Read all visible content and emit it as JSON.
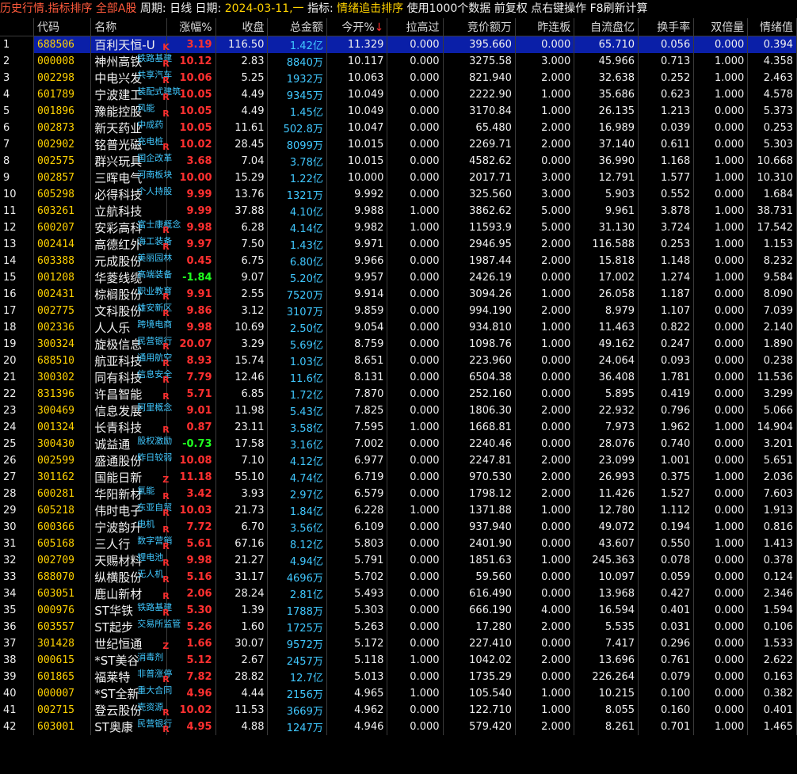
{
  "titlebar": {
    "part1": "历史行情.指标排序",
    "part2": " 全部A股",
    "part3": " 周期: 日线",
    "part4": " 日期: ",
    "date": "2024-03-11,一",
    "part5": " 指标: ",
    "indicator": "情绪追击排序",
    "part6": " 使用1000个数据 前复权 点右键操作 F8刷新计算"
  },
  "columns": [
    "",
    "代码",
    "名称",
    "涨幅%",
    "收盘",
    "总金额",
    "今开%",
    "拉高过",
    "竞价额万",
    "昨连板",
    "自流盘亿",
    "换手率",
    "双倍量",
    "情绪值"
  ],
  "sort_arrow": "↓",
  "rows": [
    {
      "i": "1",
      "code": "688506",
      "name": "百利天恒-U",
      "concept": "",
      "mark": "K",
      "chg": "3.19",
      "close": "116.50",
      "amt": "1.42亿",
      "open": "11.329",
      "lg": "0.000",
      "bid": "395.660",
      "lb": "0.000",
      "cap": "65.710",
      "turn": "0.056",
      "dv": "0.000",
      "emo": "0.394"
    },
    {
      "i": "2",
      "code": "000008",
      "name": "神州高铁",
      "concept": "铁路基建",
      "mark": "R",
      "chg": "10.12",
      "close": "2.83",
      "amt": "8840万",
      "open": "10.117",
      "lg": "0.000",
      "bid": "3275.58",
      "lb": "3.000",
      "cap": "45.966",
      "turn": "0.713",
      "dv": "1.000",
      "emo": "4.358"
    },
    {
      "i": "3",
      "code": "002298",
      "name": "中电兴发",
      "concept": "共享汽车",
      "mark": "R",
      "chg": "10.06",
      "close": "5.25",
      "amt": "1932万",
      "open": "10.063",
      "lg": "0.000",
      "bid": "821.940",
      "lb": "2.000",
      "cap": "32.638",
      "turn": "0.252",
      "dv": "1.000",
      "emo": "2.463"
    },
    {
      "i": "4",
      "code": "601789",
      "name": "宁波建工",
      "concept": "装配式建筑",
      "mark": "R",
      "chg": "10.05",
      "close": "4.49",
      "amt": "9345万",
      "open": "10.049",
      "lg": "0.000",
      "bid": "2222.90",
      "lb": "1.000",
      "cap": "35.686",
      "turn": "0.623",
      "dv": "1.000",
      "emo": "4.578"
    },
    {
      "i": "5",
      "code": "001896",
      "name": "豫能控股",
      "concept": "风能",
      "mark": "R",
      "chg": "10.05",
      "close": "4.49",
      "amt": "1.45亿",
      "open": "10.049",
      "lg": "0.000",
      "bid": "3170.84",
      "lb": "1.000",
      "cap": "26.135",
      "turn": "1.213",
      "dv": "0.000",
      "emo": "5.373"
    },
    {
      "i": "6",
      "code": "002873",
      "name": "新天药业",
      "concept": "中成药",
      "mark": "",
      "chg": "10.05",
      "close": "11.61",
      "amt": "502.8万",
      "open": "10.047",
      "lg": "0.000",
      "bid": "65.480",
      "lb": "2.000",
      "cap": "16.989",
      "turn": "0.039",
      "dv": "0.000",
      "emo": "0.253"
    },
    {
      "i": "7",
      "code": "002902",
      "name": "铭普光磁",
      "concept": "充电桩",
      "mark": "R",
      "chg": "10.02",
      "close": "28.45",
      "amt": "8099万",
      "open": "10.015",
      "lg": "0.000",
      "bid": "2269.71",
      "lb": "2.000",
      "cap": "37.140",
      "turn": "0.611",
      "dv": "0.000",
      "emo": "5.303"
    },
    {
      "i": "8",
      "code": "002575",
      "name": "群兴玩具",
      "concept": "国企改革",
      "mark": "",
      "chg": "3.68",
      "close": "7.04",
      "amt": "3.78亿",
      "open": "10.015",
      "lg": "0.000",
      "bid": "4582.62",
      "lb": "0.000",
      "cap": "36.990",
      "turn": "1.168",
      "dv": "1.000",
      "emo": "10.668"
    },
    {
      "i": "9",
      "code": "002857",
      "name": "三晖电气",
      "concept": "河南板块",
      "mark": "",
      "chg": "10.00",
      "close": "15.29",
      "amt": "1.22亿",
      "open": "10.000",
      "lg": "0.000",
      "bid": "2017.71",
      "lb": "3.000",
      "cap": "12.791",
      "turn": "1.577",
      "dv": "1.000",
      "emo": "10.310"
    },
    {
      "i": "10",
      "code": "605298",
      "name": "必得科技",
      "concept": "个人持股",
      "mark": "",
      "chg": "9.99",
      "close": "13.76",
      "amt": "1321万",
      "open": "9.992",
      "lg": "0.000",
      "bid": "325.560",
      "lb": "3.000",
      "cap": "5.903",
      "turn": "0.552",
      "dv": "0.000",
      "emo": "1.684"
    },
    {
      "i": "11",
      "code": "603261",
      "name": "立航科技",
      "concept": "",
      "mark": "",
      "chg": "9.99",
      "close": "37.88",
      "amt": "4.10亿",
      "open": "9.988",
      "lg": "1.000",
      "bid": "3862.62",
      "lb": "5.000",
      "cap": "9.961",
      "turn": "3.878",
      "dv": "1.000",
      "emo": "38.731"
    },
    {
      "i": "12",
      "code": "600207",
      "name": "安彩高科",
      "concept": "富士康概念",
      "mark": "R",
      "chg": "9.98",
      "close": "6.28",
      "amt": "4.14亿",
      "open": "9.982",
      "lg": "1.000",
      "bid": "11593.9",
      "lb": "5.000",
      "cap": "31.130",
      "turn": "3.724",
      "dv": "1.000",
      "emo": "17.542"
    },
    {
      "i": "13",
      "code": "002414",
      "name": "高德红外",
      "concept": "海工装备",
      "mark": "R",
      "chg": "9.97",
      "close": "7.50",
      "amt": "1.43亿",
      "open": "9.971",
      "lg": "0.000",
      "bid": "2946.95",
      "lb": "2.000",
      "cap": "116.588",
      "turn": "0.253",
      "dv": "1.000",
      "emo": "1.153"
    },
    {
      "i": "14",
      "code": "603388",
      "name": "元成股份",
      "concept": "美丽园林",
      "mark": "",
      "chg": "0.45",
      "close": "6.75",
      "amt": "6.80亿",
      "open": "9.966",
      "lg": "0.000",
      "bid": "1987.44",
      "lb": "2.000",
      "cap": "15.818",
      "turn": "1.148",
      "dv": "0.000",
      "emo": "8.232"
    },
    {
      "i": "15",
      "code": "001208",
      "name": "华菱线缆",
      "concept": "高端装备",
      "mark": "",
      "chg": "-1.84",
      "close": "9.07",
      "amt": "5.20亿",
      "open": "9.957",
      "lg": "0.000",
      "bid": "2426.19",
      "lb": "0.000",
      "cap": "17.002",
      "turn": "1.274",
      "dv": "1.000",
      "emo": "9.584"
    },
    {
      "i": "16",
      "code": "002431",
      "name": "棕榈股份",
      "concept": "职业教育",
      "mark": "R",
      "chg": "9.91",
      "close": "2.55",
      "amt": "7520万",
      "open": "9.914",
      "lg": "0.000",
      "bid": "3094.26",
      "lb": "1.000",
      "cap": "26.058",
      "turn": "1.187",
      "dv": "0.000",
      "emo": "8.090"
    },
    {
      "i": "17",
      "code": "002775",
      "name": "文科股份",
      "concept": "雄安新区",
      "mark": "R",
      "chg": "9.86",
      "close": "3.12",
      "amt": "3107万",
      "open": "9.859",
      "lg": "0.000",
      "bid": "994.190",
      "lb": "2.000",
      "cap": "8.979",
      "turn": "1.107",
      "dv": "0.000",
      "emo": "7.039"
    },
    {
      "i": "18",
      "code": "002336",
      "name": "人人乐",
      "concept": "跨境电商",
      "mark": "",
      "chg": "9.98",
      "close": "10.69",
      "amt": "2.50亿",
      "open": "9.054",
      "lg": "0.000",
      "bid": "934.810",
      "lb": "1.000",
      "cap": "11.463",
      "turn": "0.822",
      "dv": "0.000",
      "emo": "2.140"
    },
    {
      "i": "19",
      "code": "300324",
      "name": "旋极信息",
      "concept": "民营银行",
      "mark": "R",
      "chg": "20.07",
      "close": "3.29",
      "amt": "5.69亿",
      "open": "8.759",
      "lg": "0.000",
      "bid": "1098.76",
      "lb": "1.000",
      "cap": "49.162",
      "turn": "0.247",
      "dv": "0.000",
      "emo": "1.890"
    },
    {
      "i": "20",
      "code": "688510",
      "name": "航亚科技",
      "concept": "通用航空",
      "mark": "R",
      "chg": "8.93",
      "close": "15.74",
      "amt": "1.03亿",
      "open": "8.651",
      "lg": "0.000",
      "bid": "223.960",
      "lb": "0.000",
      "cap": "24.064",
      "turn": "0.093",
      "dv": "0.000",
      "emo": "0.238"
    },
    {
      "i": "21",
      "code": "300302",
      "name": "同有科技",
      "concept": "信息安全",
      "mark": "R",
      "chg": "7.79",
      "close": "12.46",
      "amt": "11.6亿",
      "open": "8.131",
      "lg": "0.000",
      "bid": "6504.38",
      "lb": "0.000",
      "cap": "36.408",
      "turn": "1.781",
      "dv": "0.000",
      "emo": "11.536"
    },
    {
      "i": "22",
      "code": "831396",
      "name": "许昌智能",
      "concept": "",
      "mark": "R",
      "chg": "5.71",
      "close": "6.85",
      "amt": "1.72亿",
      "open": "7.870",
      "lg": "0.000",
      "bid": "252.160",
      "lb": "0.000",
      "cap": "5.895",
      "turn": "0.419",
      "dv": "0.000",
      "emo": "3.299"
    },
    {
      "i": "23",
      "code": "300469",
      "name": "信息发展",
      "concept": "阿里概念",
      "mark": "",
      "chg": "9.01",
      "close": "11.98",
      "amt": "5.43亿",
      "open": "7.825",
      "lg": "0.000",
      "bid": "1806.30",
      "lb": "2.000",
      "cap": "22.932",
      "turn": "0.796",
      "dv": "0.000",
      "emo": "5.066"
    },
    {
      "i": "24",
      "code": "001324",
      "name": "长青科技",
      "concept": "",
      "mark": "R",
      "chg": "0.87",
      "close": "23.11",
      "amt": "3.58亿",
      "open": "7.595",
      "lg": "1.000",
      "bid": "1668.81",
      "lb": "0.000",
      "cap": "7.973",
      "turn": "1.962",
      "dv": "1.000",
      "emo": "14.904"
    },
    {
      "i": "25",
      "code": "300430",
      "name": "诚益通",
      "concept": "股权激励",
      "mark": "",
      "chg": "-0.73",
      "close": "17.58",
      "amt": "3.16亿",
      "open": "7.002",
      "lg": "0.000",
      "bid": "2240.46",
      "lb": "0.000",
      "cap": "28.076",
      "turn": "0.740",
      "dv": "0.000",
      "emo": "3.201"
    },
    {
      "i": "26",
      "code": "002599",
      "name": "盛通股份",
      "concept": "昨日较弱",
      "mark": "",
      "chg": "10.08",
      "close": "7.10",
      "amt": "4.12亿",
      "open": "6.977",
      "lg": "0.000",
      "bid": "2247.81",
      "lb": "2.000",
      "cap": "23.099",
      "turn": "1.001",
      "dv": "0.000",
      "emo": "5.651"
    },
    {
      "i": "27",
      "code": "301162",
      "name": "国能日新",
      "concept": "",
      "mark": "Z",
      "chg": "11.18",
      "close": "55.10",
      "amt": "4.74亿",
      "open": "6.719",
      "lg": "0.000",
      "bid": "970.530",
      "lb": "2.000",
      "cap": "26.993",
      "turn": "0.375",
      "dv": "1.000",
      "emo": "2.036"
    },
    {
      "i": "28",
      "code": "600281",
      "name": "华阳新材",
      "concept": "氢能",
      "mark": "R",
      "chg": "3.42",
      "close": "3.93",
      "amt": "2.97亿",
      "open": "6.579",
      "lg": "0.000",
      "bid": "1798.12",
      "lb": "2.000",
      "cap": "11.426",
      "turn": "1.527",
      "dv": "0.000",
      "emo": "7.603"
    },
    {
      "i": "29",
      "code": "605218",
      "name": "伟时电子",
      "concept": "东亚自贸",
      "mark": "R",
      "chg": "10.03",
      "close": "21.73",
      "amt": "1.84亿",
      "open": "6.228",
      "lg": "1.000",
      "bid": "1371.88",
      "lb": "1.000",
      "cap": "12.780",
      "turn": "1.112",
      "dv": "0.000",
      "emo": "1.913"
    },
    {
      "i": "30",
      "code": "600366",
      "name": "宁波韵升",
      "concept": "电机",
      "mark": "R",
      "chg": "7.72",
      "close": "6.70",
      "amt": "3.56亿",
      "open": "6.109",
      "lg": "0.000",
      "bid": "937.940",
      "lb": "0.000",
      "cap": "49.072",
      "turn": "0.194",
      "dv": "1.000",
      "emo": "0.816"
    },
    {
      "i": "31",
      "code": "605168",
      "name": "三人行",
      "concept": "数字营销",
      "mark": "R",
      "chg": "5.61",
      "close": "67.16",
      "amt": "8.12亿",
      "open": "5.803",
      "lg": "0.000",
      "bid": "2401.90",
      "lb": "0.000",
      "cap": "43.607",
      "turn": "0.550",
      "dv": "1.000",
      "emo": "1.413"
    },
    {
      "i": "32",
      "code": "002709",
      "name": "天赐材料",
      "concept": "锂电池",
      "mark": "R",
      "chg": "9.98",
      "close": "21.27",
      "amt": "4.94亿",
      "open": "5.791",
      "lg": "0.000",
      "bid": "1851.63",
      "lb": "1.000",
      "cap": "245.363",
      "turn": "0.078",
      "dv": "0.000",
      "emo": "0.378"
    },
    {
      "i": "33",
      "code": "688070",
      "name": "纵横股份",
      "concept": "无人机",
      "mark": "R",
      "chg": "5.16",
      "close": "31.17",
      "amt": "4696万",
      "open": "5.702",
      "lg": "0.000",
      "bid": "59.560",
      "lb": "0.000",
      "cap": "10.097",
      "turn": "0.059",
      "dv": "0.000",
      "emo": "0.124"
    },
    {
      "i": "34",
      "code": "603051",
      "name": "鹿山新材",
      "concept": "",
      "mark": "R",
      "chg": "2.06",
      "close": "28.24",
      "amt": "2.81亿",
      "open": "5.493",
      "lg": "0.000",
      "bid": "616.490",
      "lb": "0.000",
      "cap": "13.968",
      "turn": "0.427",
      "dv": "0.000",
      "emo": "2.346"
    },
    {
      "i": "35",
      "code": "000976",
      "name": "ST华铁",
      "concept": "铁路基建",
      "mark": "R",
      "chg": "5.30",
      "close": "1.39",
      "amt": "1788万",
      "open": "5.303",
      "lg": "0.000",
      "bid": "666.190",
      "lb": "4.000",
      "cap": "16.594",
      "turn": "0.401",
      "dv": "0.000",
      "emo": "1.594"
    },
    {
      "i": "36",
      "code": "603557",
      "name": "ST起步",
      "concept": "交易所监管",
      "mark": "",
      "chg": "5.26",
      "close": "1.60",
      "amt": "1725万",
      "open": "5.263",
      "lg": "0.000",
      "bid": "17.280",
      "lb": "2.000",
      "cap": "5.535",
      "turn": "0.031",
      "dv": "0.000",
      "emo": "0.106"
    },
    {
      "i": "37",
      "code": "301428",
      "name": "世纪恒通",
      "concept": "",
      "mark": "Z",
      "chg": "1.66",
      "close": "30.07",
      "amt": "9572万",
      "open": "5.172",
      "lg": "0.000",
      "bid": "227.410",
      "lb": "0.000",
      "cap": "7.417",
      "turn": "0.296",
      "dv": "0.000",
      "emo": "1.533"
    },
    {
      "i": "38",
      "code": "000615",
      "name": "*ST美谷",
      "concept": "消毒剂",
      "mark": "",
      "chg": "5.12",
      "close": "2.67",
      "amt": "2457万",
      "open": "5.118",
      "lg": "1.000",
      "bid": "1042.02",
      "lb": "2.000",
      "cap": "13.696",
      "turn": "0.761",
      "dv": "0.000",
      "emo": "2.622"
    },
    {
      "i": "39",
      "code": "601865",
      "name": "福莱特",
      "concept": "非普涨停",
      "mark": "R",
      "chg": "7.82",
      "close": "28.82",
      "amt": "12.7亿",
      "open": "5.013",
      "lg": "0.000",
      "bid": "1735.29",
      "lb": "0.000",
      "cap": "226.264",
      "turn": "0.079",
      "dv": "0.000",
      "emo": "0.163"
    },
    {
      "i": "40",
      "code": "000007",
      "name": "*ST全新",
      "concept": "重大合同",
      "mark": "",
      "chg": "4.96",
      "close": "4.44",
      "amt": "2156万",
      "open": "4.965",
      "lg": "1.000",
      "bid": "105.540",
      "lb": "1.000",
      "cap": "10.215",
      "turn": "0.100",
      "dv": "0.000",
      "emo": "0.382"
    },
    {
      "i": "41",
      "code": "002715",
      "name": "登云股份",
      "concept": "壳资源",
      "mark": "R",
      "chg": "10.02",
      "close": "11.53",
      "amt": "3669万",
      "open": "4.962",
      "lg": "0.000",
      "bid": "122.710",
      "lb": "1.000",
      "cap": "8.055",
      "turn": "0.160",
      "dv": "0.000",
      "emo": "0.401"
    },
    {
      "i": "42",
      "code": "603001",
      "name": "ST奥康",
      "concept": "民营银行",
      "mark": "R",
      "chg": "4.95",
      "close": "4.88",
      "amt": "1247万",
      "open": "4.946",
      "lg": "0.000",
      "bid": "579.420",
      "lb": "2.000",
      "cap": "8.261",
      "turn": "0.701",
      "dv": "1.000",
      "emo": "1.465"
    }
  ]
}
